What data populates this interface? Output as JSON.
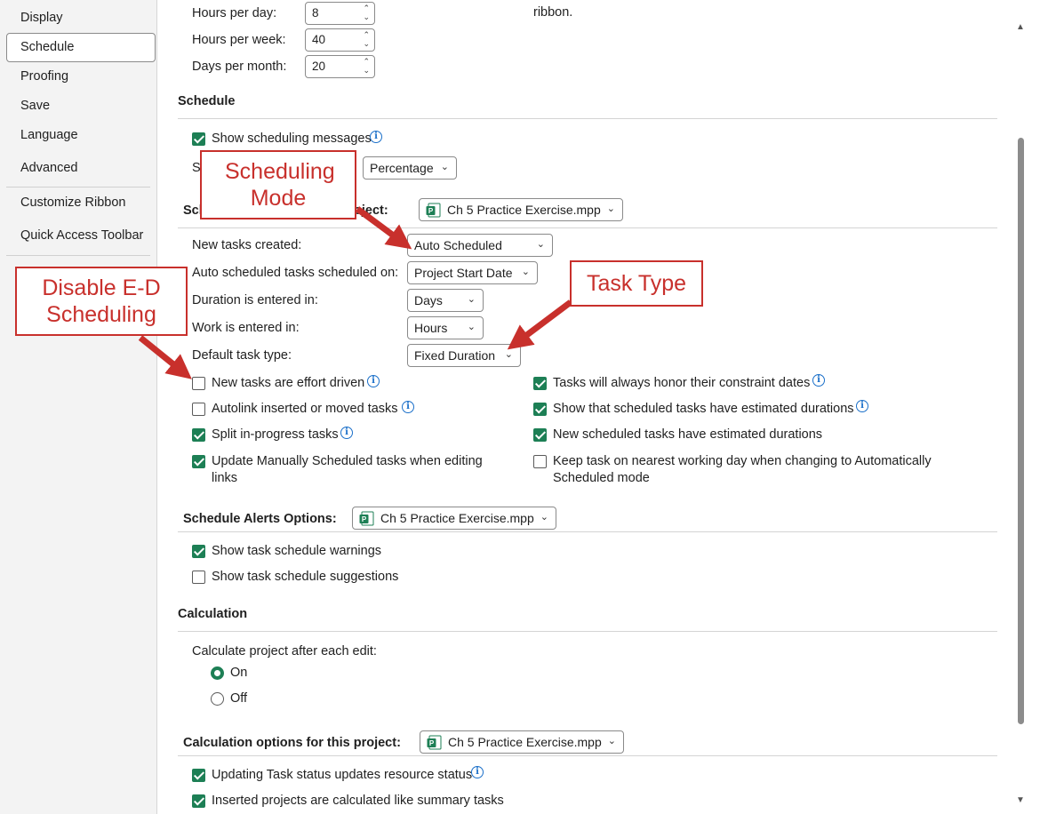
{
  "sidebar": {
    "items": [
      "Display",
      "Schedule",
      "Proofing",
      "Save",
      "Language",
      "Advanced",
      "Customize Ribbon",
      "Quick Access Toolbar"
    ],
    "selected": "Schedule"
  },
  "top": {
    "hours_per_day_label": "Hours per day:",
    "hours_per_day": "8",
    "hours_per_week_label": "Hours per week:",
    "hours_per_week": "40",
    "days_per_month_label": "Days per month:",
    "days_per_month": "20",
    "ribbon_text": "ribbon."
  },
  "schedule": {
    "header": "Schedule",
    "show_messages_label": "Show scheduling messages",
    "show_messages_checked": true,
    "partial_s": "S",
    "units_value": "Percentage",
    "options_partial_left": "Sch",
    "options_partial_right": "oject:",
    "project_file": "Ch 5 Practice Exercise.mpp",
    "new_tasks_label": "New tasks created:",
    "new_tasks_value": "Auto Scheduled",
    "auto_sched_label": "Auto scheduled tasks scheduled on:",
    "auto_sched_value": "Project Start Date",
    "duration_label": "Duration is entered in:",
    "duration_value": "Days",
    "work_label": "Work is entered in:",
    "work_value": "Hours",
    "task_type_label": "Default task type:",
    "task_type_value": "Fixed Duration",
    "checks_left": [
      {
        "label": "New tasks are effort driven",
        "checked": false,
        "info": true
      },
      {
        "label": "Autolink inserted or moved tasks",
        "checked": false,
        "info": true
      },
      {
        "label": "Split in-progress tasks",
        "checked": true,
        "info": true
      },
      {
        "label": "Update Manually Scheduled tasks when editing",
        "label2": "links",
        "checked": true,
        "info": false
      }
    ],
    "checks_right": [
      {
        "label": "Tasks will always honor their constraint dates",
        "checked": true,
        "info": true
      },
      {
        "label": "Show that scheduled tasks have estimated durations",
        "checked": true,
        "info": true
      },
      {
        "label": "New scheduled tasks have estimated durations",
        "checked": true,
        "info": false
      },
      {
        "label": "Keep task on nearest working day when changing to Automatically",
        "label2": "Scheduled mode",
        "checked": false,
        "info": false
      }
    ]
  },
  "alerts": {
    "header": "Schedule Alerts Options:",
    "project_file": "Ch 5 Practice Exercise.mpp",
    "warnings_label": "Show task schedule warnings",
    "warnings_checked": true,
    "suggestions_label": "Show task schedule suggestions",
    "suggestions_checked": false
  },
  "calculation": {
    "header": "Calculation",
    "after_edit_label": "Calculate project after each edit:",
    "on_label": "On",
    "off_label": "Off",
    "selected": "On",
    "options_header": "Calculation options for this project:",
    "project_file": "Ch 5 Practice Exercise.mpp",
    "status_label": "Updating Task status updates resource status",
    "status_checked": true,
    "inserted_label": "Inserted projects are calculated like summary tasks",
    "inserted_checked": true
  },
  "callouts": {
    "scheduling_mode": "Scheduling Mode",
    "disable_ed": "Disable E-D Scheduling",
    "task_type": "Task Type"
  },
  "colors": {
    "accent": "#1d7f55",
    "callout": "#c8302c",
    "info": "#1a6fc9"
  }
}
